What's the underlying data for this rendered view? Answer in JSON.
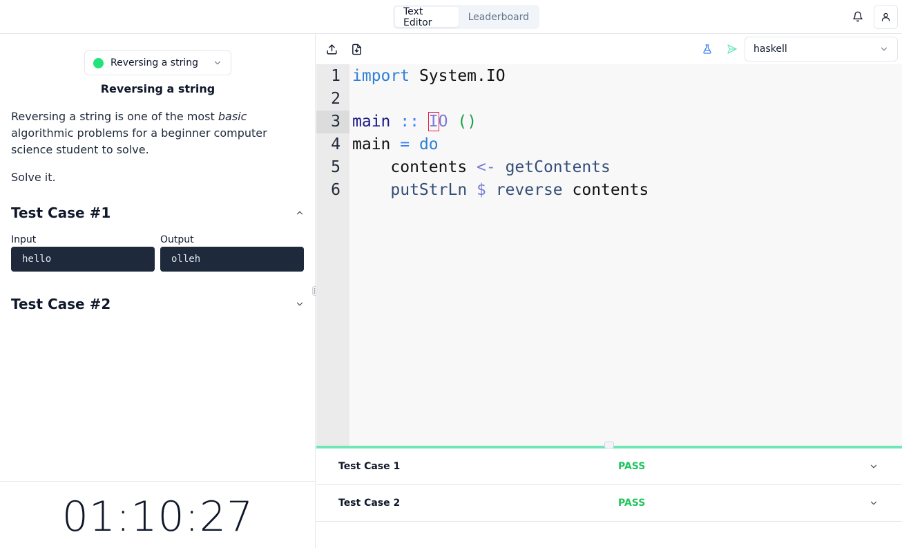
{
  "header": {
    "tabs": [
      {
        "label": "Text Editor",
        "active": true
      },
      {
        "label": "Leaderboard",
        "active": false
      }
    ],
    "icons": [
      "bell-icon",
      "user-icon"
    ]
  },
  "problem": {
    "selector_label": "Reversing a string",
    "status_color": "#22e37a",
    "title": "Reversing a string",
    "description_before": "Reversing a string is one of the most ",
    "description_emphasis": "basic",
    "description_after": " algorithmic problems for a beginner computer science student to solve.",
    "instruction": "Solve it.",
    "test_cases": [
      {
        "title": "Test Case #1",
        "expanded": true,
        "input_label": "Input",
        "input": "hello",
        "output_label": "Output",
        "output": "olleh"
      },
      {
        "title": "Test Case #2",
        "expanded": false
      }
    ]
  },
  "timer": "01:10:27",
  "toolbar": {
    "language": "haskell",
    "icons": [
      "upload-icon",
      "download-file-icon",
      "flask-icon",
      "send-icon"
    ]
  },
  "editor": {
    "line_numbers": [
      "1",
      "2",
      "3",
      "4",
      "5",
      "6"
    ],
    "active_line": 3,
    "lines": [
      [
        {
          "t": "import",
          "c": "#2f7fd6"
        },
        {
          "t": " System.IO",
          "c": "#111111"
        }
      ],
      [],
      [
        {
          "t": "main",
          "c": "#1a1a8a"
        },
        {
          "t": " :: ",
          "c": "#3b82f6"
        },
        {
          "t": "I",
          "c": "#7c7cd6",
          "cursor": true
        },
        {
          "t": "O",
          "c": "#7c7cd6"
        },
        {
          "t": " ()",
          "c": "#16a34a"
        }
      ],
      [
        {
          "t": "main",
          "c": "#111111"
        },
        {
          "t": " = ",
          "c": "#3b82f6"
        },
        {
          "t": "do",
          "c": "#2f7fd6"
        }
      ],
      [
        {
          "t": "    contents",
          "c": "#111111"
        },
        {
          "t": " <- ",
          "c": "#7c7cd6"
        },
        {
          "t": "getContents",
          "c": "#334e78"
        }
      ],
      [
        {
          "t": "    putStrLn",
          "c": "#334e78"
        },
        {
          "t": " $ ",
          "c": "#7c7cd6"
        },
        {
          "t": "reverse",
          "c": "#334e78"
        },
        {
          "t": " contents",
          "c": "#111111"
        }
      ]
    ]
  },
  "results": [
    {
      "name": "Test Case 1",
      "status": "PASS"
    },
    {
      "name": "Test Case 2",
      "status": "PASS"
    }
  ],
  "colors": {
    "pass": "#22c55e",
    "splitter": "#6ee7b7",
    "send_icon": "#6ee7b7",
    "flask_icon": "#3b82f6"
  }
}
